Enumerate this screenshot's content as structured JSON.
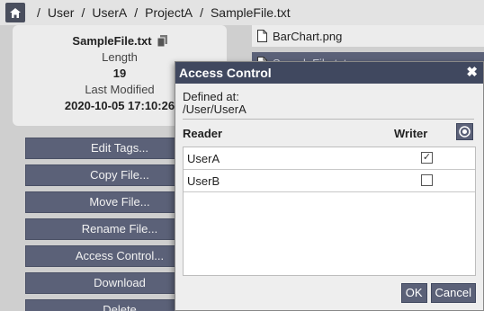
{
  "breadcrumb": {
    "home_icon": "home-icon",
    "items": [
      "User",
      "UserA",
      "ProjectA",
      "SampleFile.txt"
    ],
    "separator": "/"
  },
  "file_info": {
    "name": "SampleFile.txt",
    "copy_icon": "copy-icon",
    "length_label": "Length",
    "length_value": "19",
    "modified_label": "Last Modified",
    "modified_value": "2020-10-05 17:10:26"
  },
  "actions": [
    "Edit Tags...",
    "Copy File...",
    "Move File...",
    "Rename File...",
    "Access Control...",
    "Download",
    "Delete"
  ],
  "files": [
    {
      "name": "BarChart.png",
      "icon": "file-icon",
      "selected": false
    },
    {
      "name": "SampleFile.txt",
      "icon": "file-icon",
      "selected": true
    }
  ],
  "dialog": {
    "title": "Access Control",
    "close_label": "✖",
    "defined_label": "Defined at:",
    "defined_path": "/User/UserA",
    "col_reader": "Reader",
    "col_writer": "Writer",
    "rows": [
      {
        "name": "UserA",
        "writer": true,
        "check": "✓"
      },
      {
        "name": "UserB",
        "writer": false,
        "check": ""
      }
    ],
    "ok_label": "OK",
    "cancel_label": "Cancel"
  },
  "colors": {
    "button": "#5b6178",
    "title_bar": "#40485f",
    "background": "#cfcfcf"
  }
}
